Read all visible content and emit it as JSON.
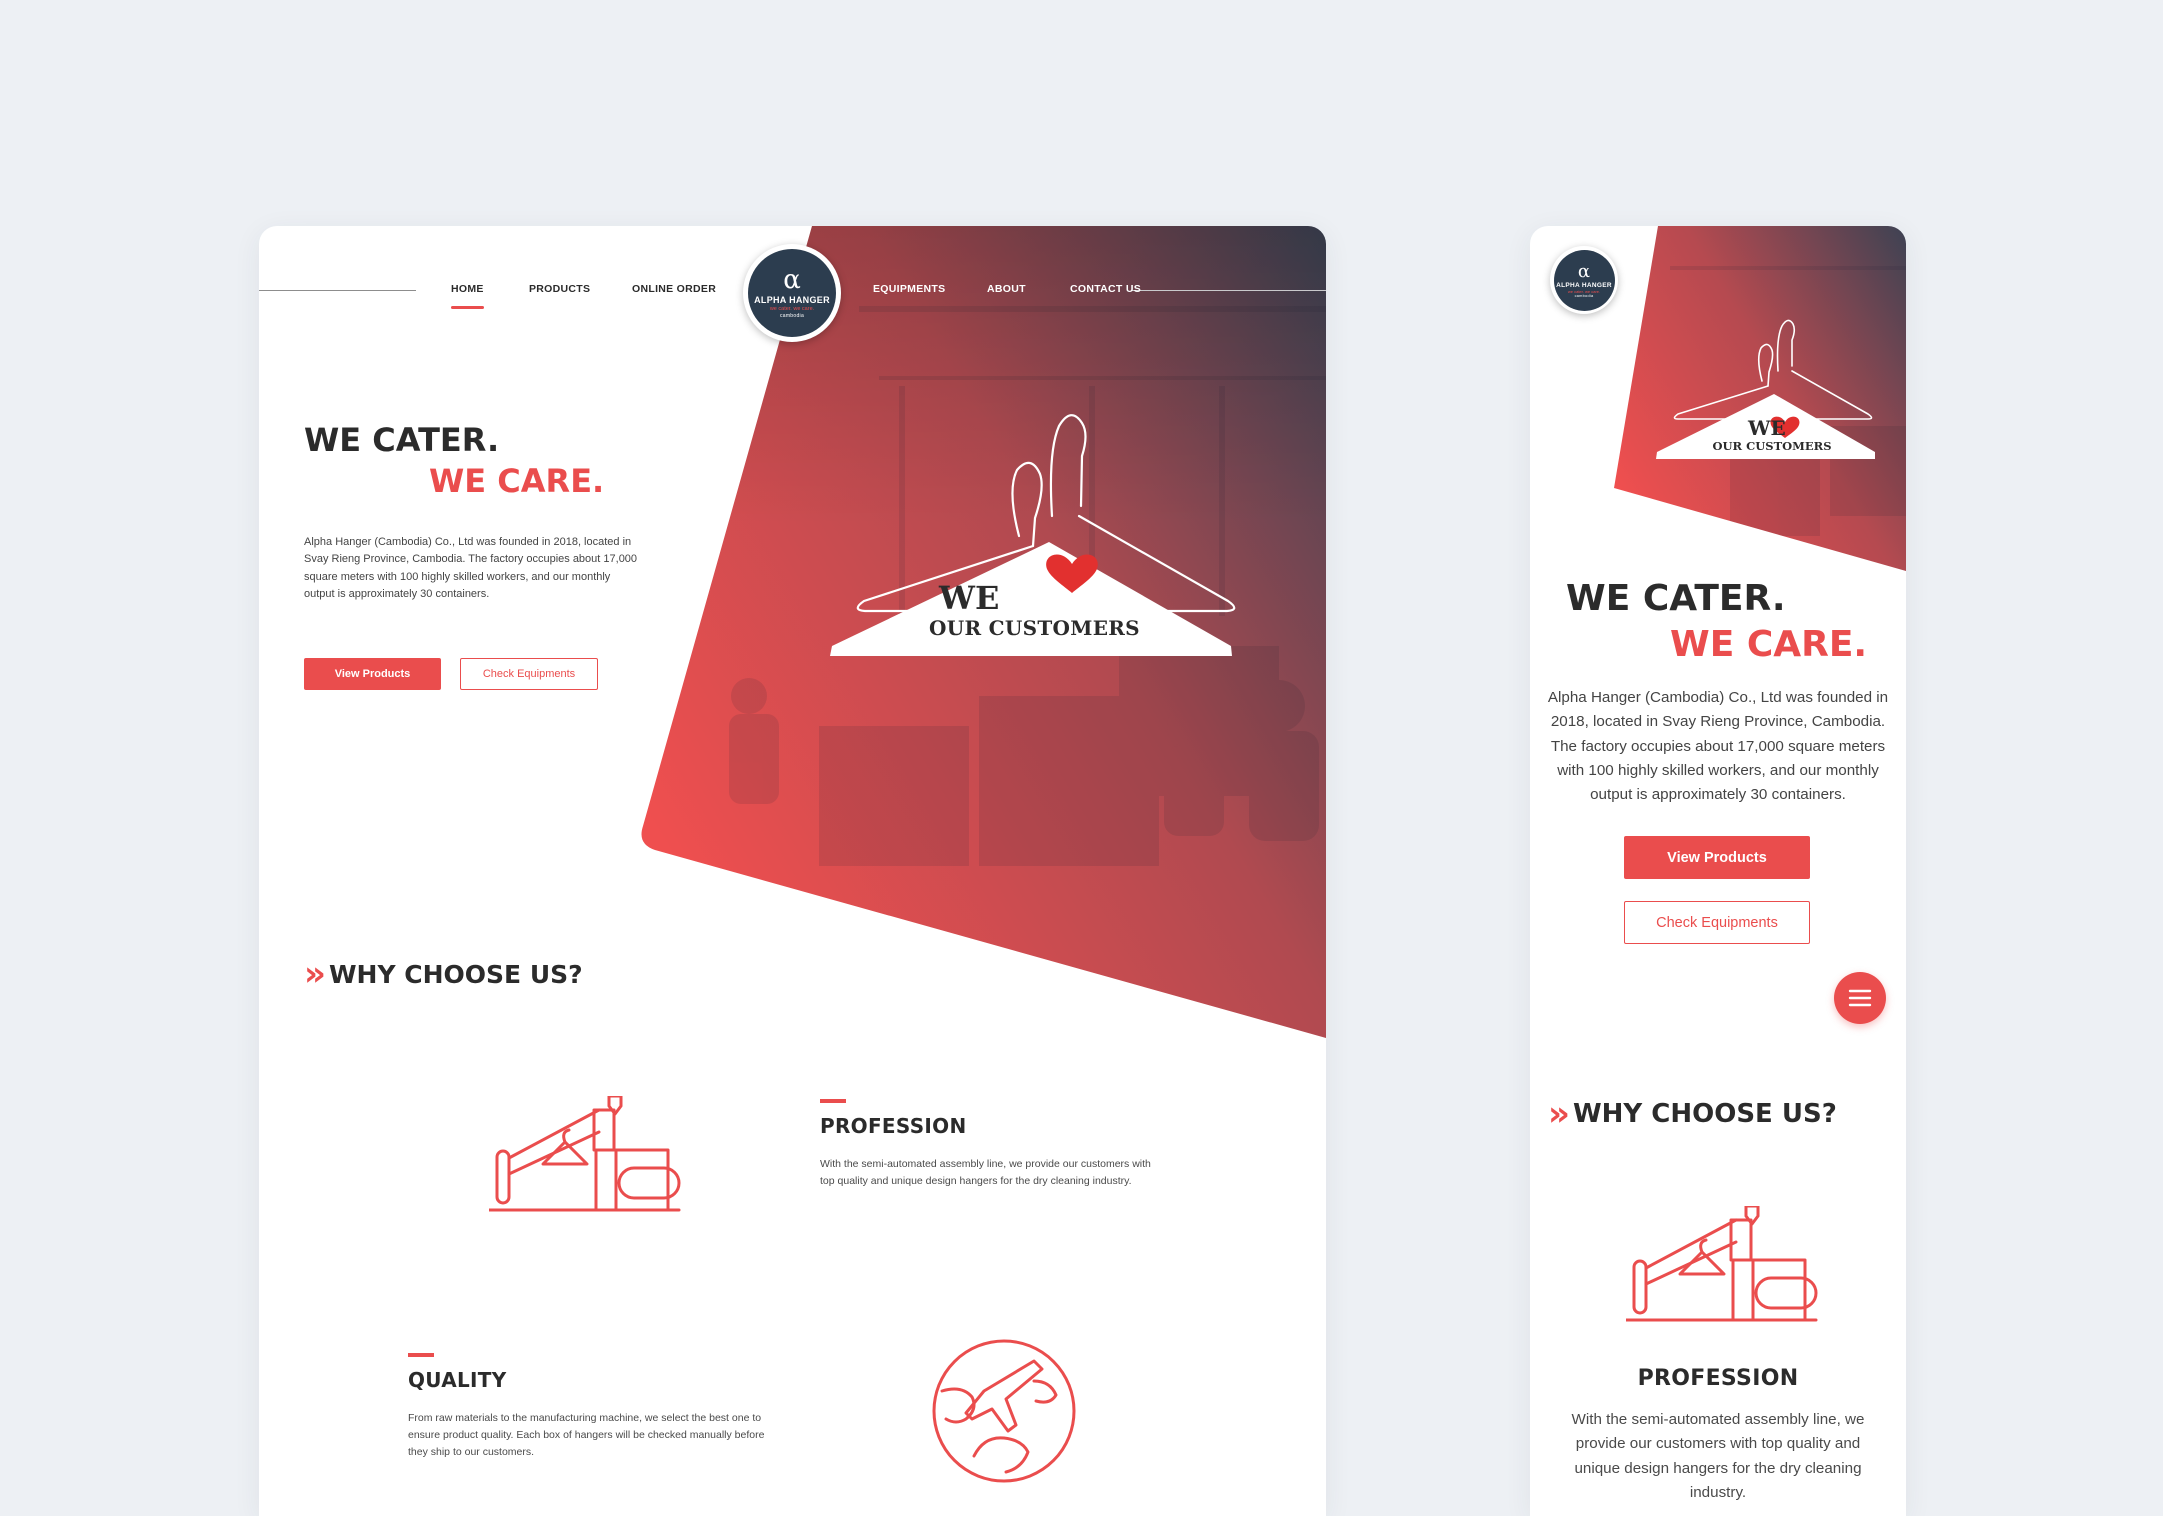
{
  "colors": {
    "accent": "#ea4d4d",
    "dark": "#2c3d4f",
    "text": "#2b2b2b",
    "page_bg": "#edf0f4"
  },
  "brand": {
    "alpha": "α",
    "name": "ALPHA HANGER",
    "tagline": "we cater. we care.",
    "country": "cambodia"
  },
  "nav": {
    "items": [
      {
        "label": "HOME",
        "active": true
      },
      {
        "label": "PRODUCTS"
      },
      {
        "label": "ONLINE ORDER"
      },
      {
        "label": "EQUIPMENTS"
      },
      {
        "label": "ABOUT"
      },
      {
        "label": "CONTACT US"
      }
    ]
  },
  "hero": {
    "line1": "WE CATER.",
    "line2": "WE CARE.",
    "description": "Alpha Hanger (Cambodia) Co., Ltd was founded in 2018, located in Svay Rieng Province, Cambodia. The factory occupies about 17,000 square meters with 100 highly skilled workers, and our monthly output is approximately 30 containers.",
    "primary_button": "View Products",
    "secondary_button": "Check Equipments",
    "hanger_we": "WE",
    "hanger_customers": "OUR CUSTOMERS"
  },
  "why": {
    "title": "WHY CHOOSE US?",
    "chevron": "»"
  },
  "features": [
    {
      "title": "PROFESSION",
      "icon": "assembly-machine-icon",
      "text": "With the semi-automated assembly line, we provide our customers with top quality and unique design hangers for the dry cleaning industry."
    },
    {
      "title": "QUALITY",
      "icon": "globe-plane-icon",
      "text": "From raw materials to the manufacturing machine, we select the best one to ensure product quality. Each box of hangers will be checked manually before they ship to our customers."
    }
  ]
}
